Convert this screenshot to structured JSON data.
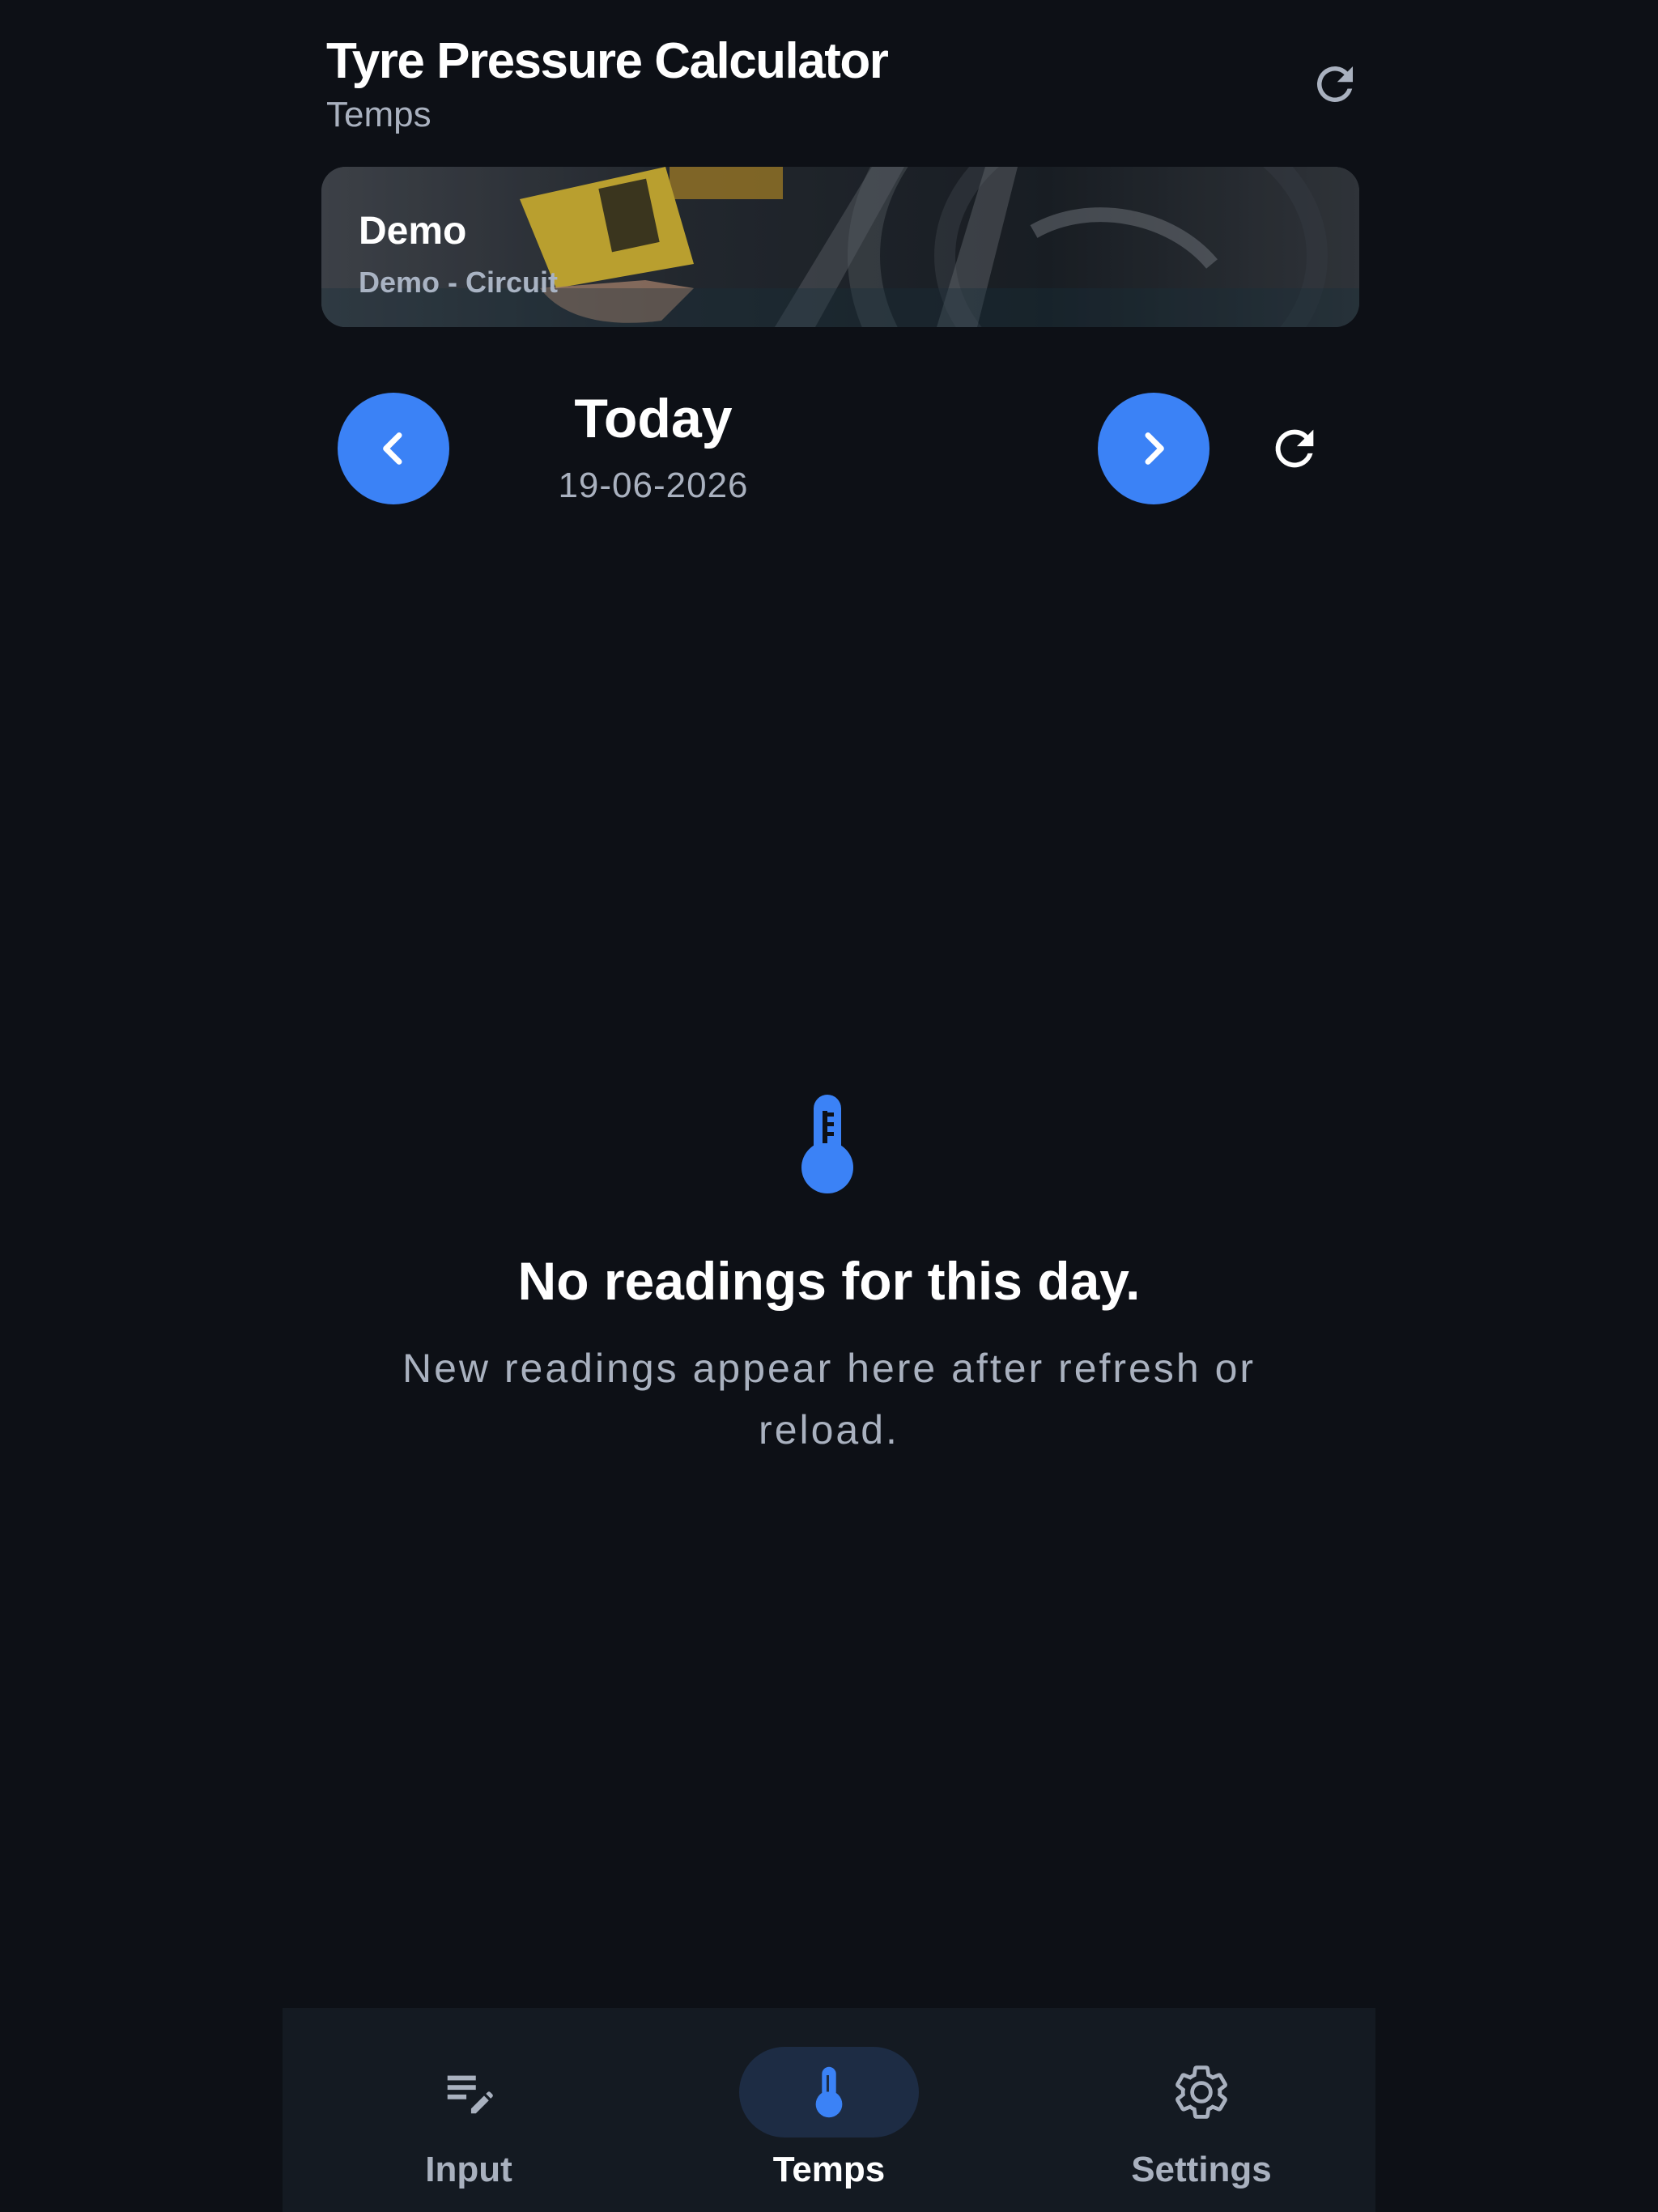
{
  "header": {
    "title": "Tyre Pressure Calculator",
    "subtitle": "Temps",
    "refresh_icon": "refresh-icon"
  },
  "session_card": {
    "title": "Demo",
    "subtitle": "Demo - Circuit",
    "image": "tyre-pressure-gauge-photo"
  },
  "day_nav": {
    "label": "Today",
    "date": "19-06-2026",
    "prev_icon": "chevron-left-icon",
    "next_icon": "chevron-right-icon",
    "refresh_icon": "refresh-icon",
    "accent_color": "#3b82f6"
  },
  "empty_state": {
    "icon": "thermometer-icon",
    "title": "No readings for this day.",
    "message": "New readings appear here after refresh or reload."
  },
  "bottom_nav": {
    "items": [
      {
        "label": "Input",
        "icon": "edit-list-icon",
        "active": false
      },
      {
        "label": "Temps",
        "icon": "thermometer-icon",
        "active": true
      },
      {
        "label": "Settings",
        "icon": "gear-icon",
        "active": false
      }
    ]
  },
  "colors": {
    "background": "#0d1016",
    "nav_background": "#141a22",
    "accent": "#3b82f6",
    "secondary_text": "#a9b1bf"
  }
}
